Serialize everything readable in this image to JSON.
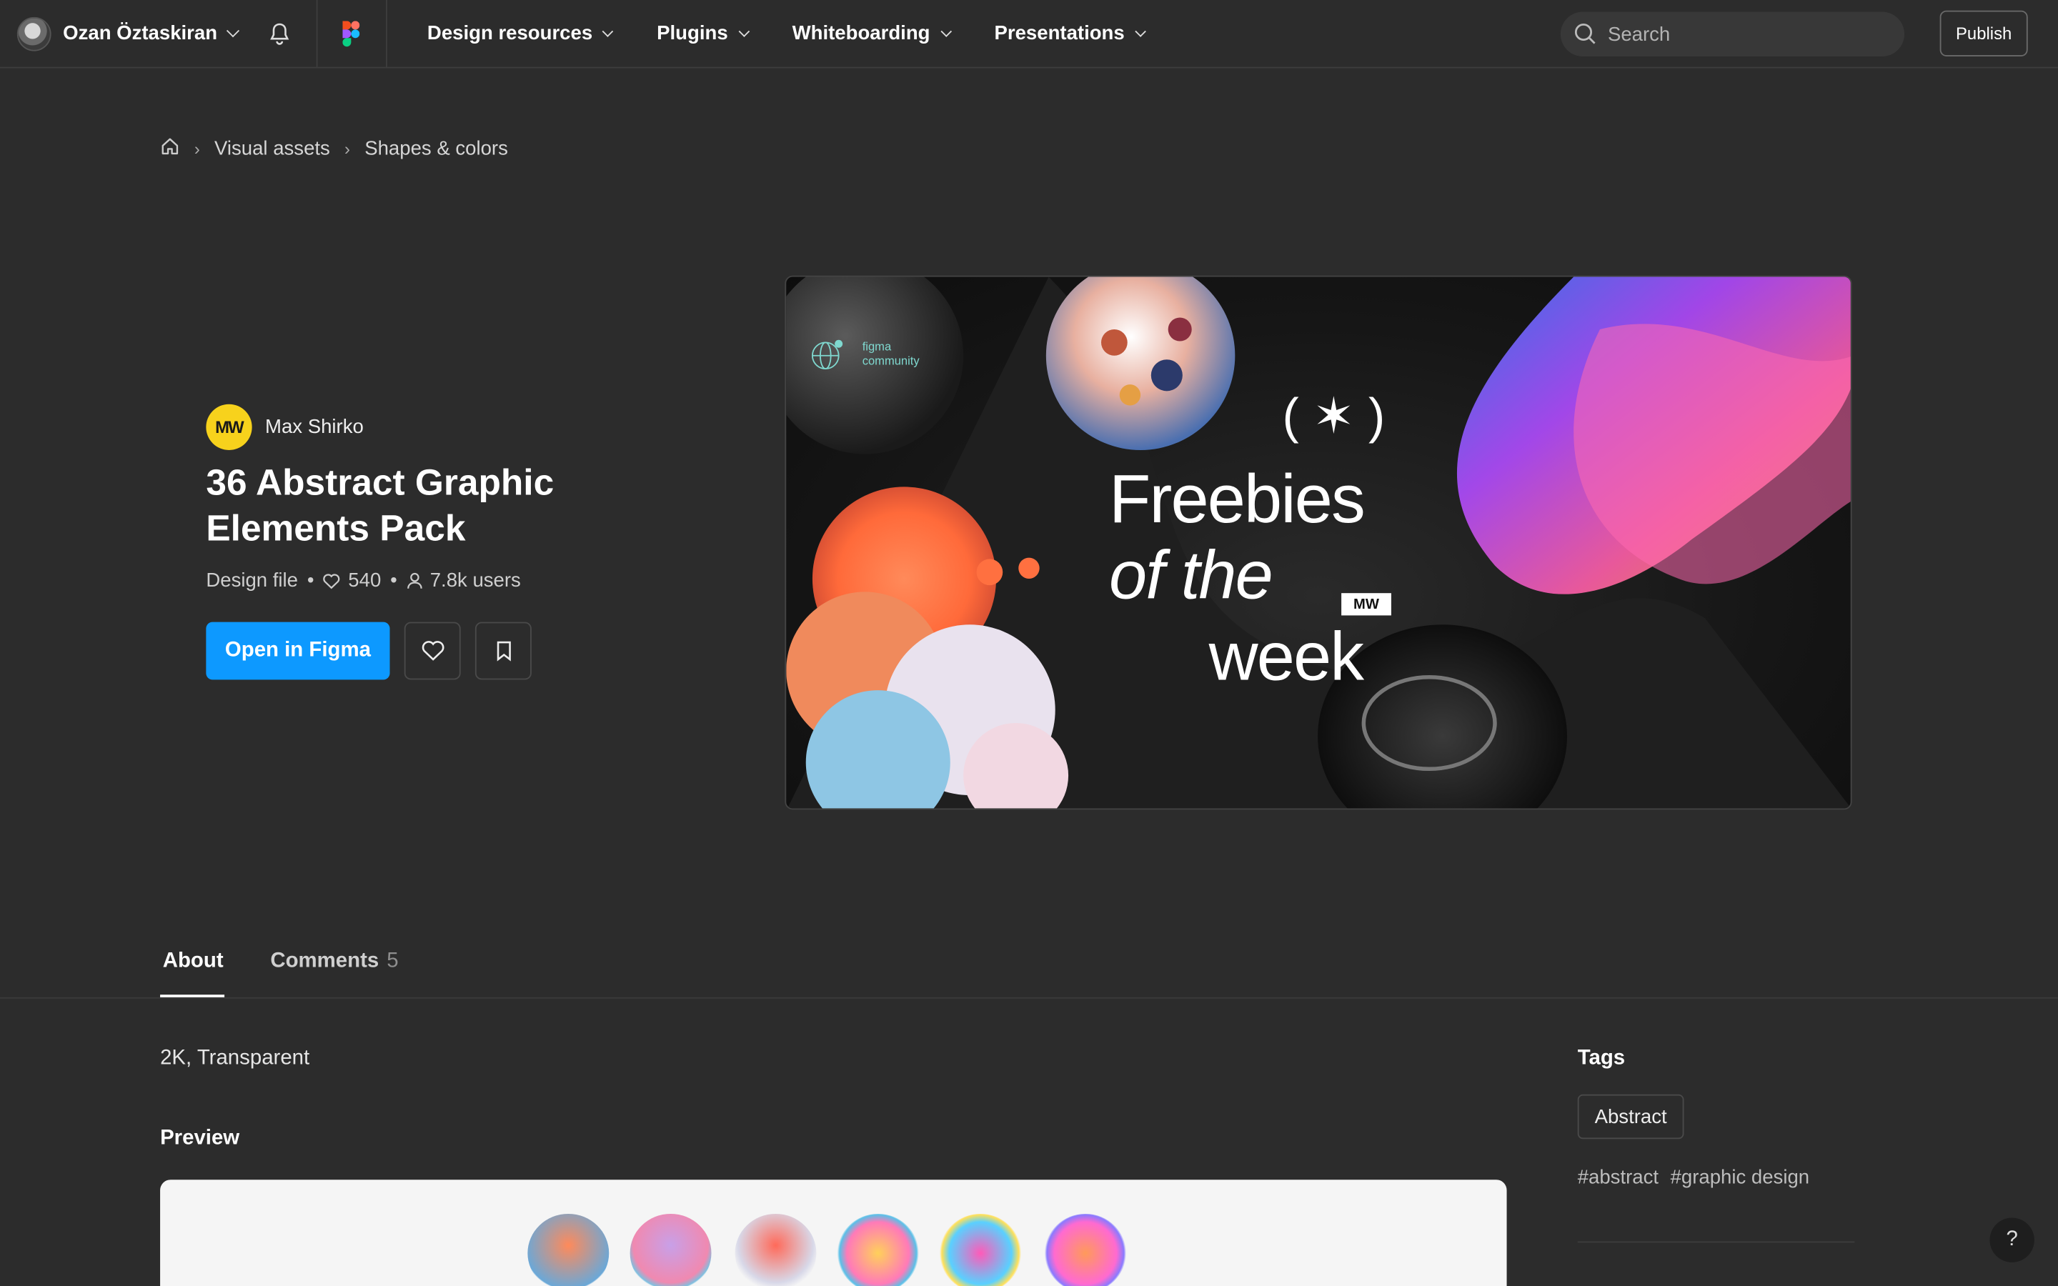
{
  "topbar": {
    "user_name": "Ozan Öztaskiran",
    "nav": [
      "Design resources",
      "Plugins",
      "Whiteboarding",
      "Presentations"
    ],
    "search_placeholder": "Search",
    "publish_label": "Publish"
  },
  "breadcrumb": {
    "items": [
      "Visual assets",
      "Shapes & colors"
    ]
  },
  "resource": {
    "author_initials": "MW",
    "author_name": "Max Shirko",
    "title": "36 Abstract Graphic Elements Pack",
    "type": "Design file",
    "likes": "540",
    "users": "7.8k users",
    "open_label": "Open in Figma"
  },
  "cover": {
    "figma_text_1": "figma",
    "figma_text_2": "community",
    "star": "( ✶ )",
    "line1": "Freebies",
    "line2": "of the",
    "line3": "week",
    "badge": "MW"
  },
  "tabs": {
    "about": "About",
    "comments": "Comments",
    "comments_count": "5"
  },
  "about": {
    "description": "2K, Transparent",
    "preview_heading": "Preview"
  },
  "tags": {
    "heading": "Tags",
    "chip": "Abstract",
    "hashtags": [
      "#abstract",
      "#graphic design"
    ]
  },
  "help": "?",
  "colors": {
    "background": "#2c2c2c",
    "accent": "#0d99ff",
    "author_badge": "#f7d21c"
  }
}
